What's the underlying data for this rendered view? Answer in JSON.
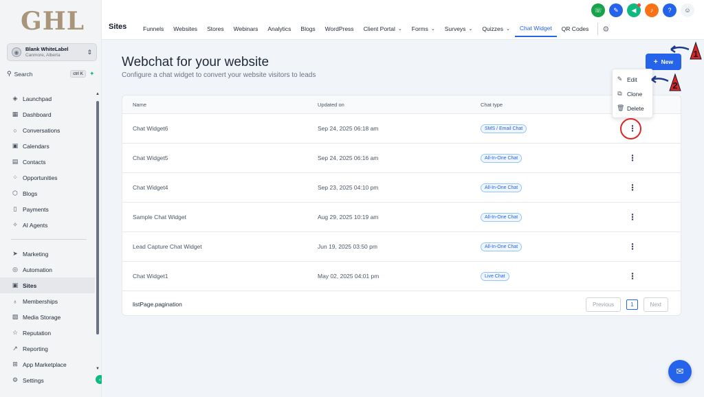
{
  "sidebar": {
    "logo": "GHL",
    "account": {
      "name": "Blank WhiteLabel",
      "location": "Canmore, Alberta"
    },
    "search": {
      "label": "Search",
      "shortcut": "ctrl K"
    },
    "items": [
      {
        "label": "Launchpad",
        "icon": "rocket-icon"
      },
      {
        "label": "Dashboard",
        "icon": "dashboard-icon"
      },
      {
        "label": "Conversations",
        "icon": "chat-icon"
      },
      {
        "label": "Calendars",
        "icon": "calendar-icon"
      },
      {
        "label": "Contacts",
        "icon": "contacts-icon"
      },
      {
        "label": "Opportunities",
        "icon": "opportunities-icon"
      },
      {
        "label": "Blogs",
        "icon": "blogs-icon"
      },
      {
        "label": "Payments",
        "icon": "payments-icon"
      },
      {
        "label": "AI Agents",
        "icon": "sparkle-icon"
      }
    ],
    "items2": [
      {
        "label": "Marketing",
        "icon": "send-icon"
      },
      {
        "label": "Automation",
        "icon": "automation-icon"
      },
      {
        "label": "Sites",
        "icon": "sites-icon",
        "active": true
      },
      {
        "label": "Memberships",
        "icon": "memberships-icon"
      },
      {
        "label": "Media Storage",
        "icon": "image-icon"
      },
      {
        "label": "Reputation",
        "icon": "star-icon"
      },
      {
        "label": "Reporting",
        "icon": "chart-icon"
      },
      {
        "label": "App Marketplace",
        "icon": "grid-icon"
      },
      {
        "label": "Settings",
        "icon": "gear-icon"
      }
    ]
  },
  "header": {
    "section": "Sites",
    "tabs": [
      {
        "label": "Funnels"
      },
      {
        "label": "Websites"
      },
      {
        "label": "Stores"
      },
      {
        "label": "Webinars"
      },
      {
        "label": "Analytics"
      },
      {
        "label": "Blogs"
      },
      {
        "label": "WordPress"
      },
      {
        "label": "Client Portal",
        "dropdown": true
      },
      {
        "label": "Forms",
        "dropdown": true
      },
      {
        "label": "Surveys",
        "dropdown": true
      },
      {
        "label": "Quizzes",
        "dropdown": true
      },
      {
        "label": "Chat Widget",
        "active": true
      },
      {
        "label": "QR Codes"
      }
    ],
    "icon_colors": {
      "phone": "#16a34a",
      "megaphone": "#2563eb",
      "announce": "#10b981",
      "bell": "#f97316",
      "help": "#2563eb"
    }
  },
  "main": {
    "title": "Webchat for your website",
    "subtitle": "Configure a chat widget to convert your website visitors to leads",
    "new_button": "New",
    "columns": {
      "name": "Name",
      "updated": "Updated on",
      "type": "Chat type"
    },
    "rows": [
      {
        "name": "Chat Widget6",
        "updated": "Sep 24, 2025 06:18 am",
        "type": "SMS / Email Chat"
      },
      {
        "name": "Chat Widget5",
        "updated": "Sep 24, 2025 06:16 am",
        "type": "All-In-One Chat"
      },
      {
        "name": "Chat Widget4",
        "updated": "Sep 23, 2025 04:10 pm",
        "type": "All-In-One Chat"
      },
      {
        "name": "Sample Chat Widget",
        "updated": "Aug 29, 2025 10:19 am",
        "type": "All-In-One Chat"
      },
      {
        "name": "Lead Capture Chat Widget",
        "updated": "Jun 19, 2025 03:50 pm",
        "type": "All-In-One Chat"
      },
      {
        "name": "Chat Widget1",
        "updated": "May 02, 2025 04:01 pm",
        "type": "Live Chat"
      }
    ],
    "pagination": {
      "label": "listPage.pagination",
      "previous": "Previous",
      "page": "1",
      "next": "Next"
    },
    "menu": {
      "edit": "Edit",
      "clone": "Clone",
      "delete": "Delete"
    },
    "annotations": {
      "step1": "1",
      "step2": "2"
    }
  }
}
